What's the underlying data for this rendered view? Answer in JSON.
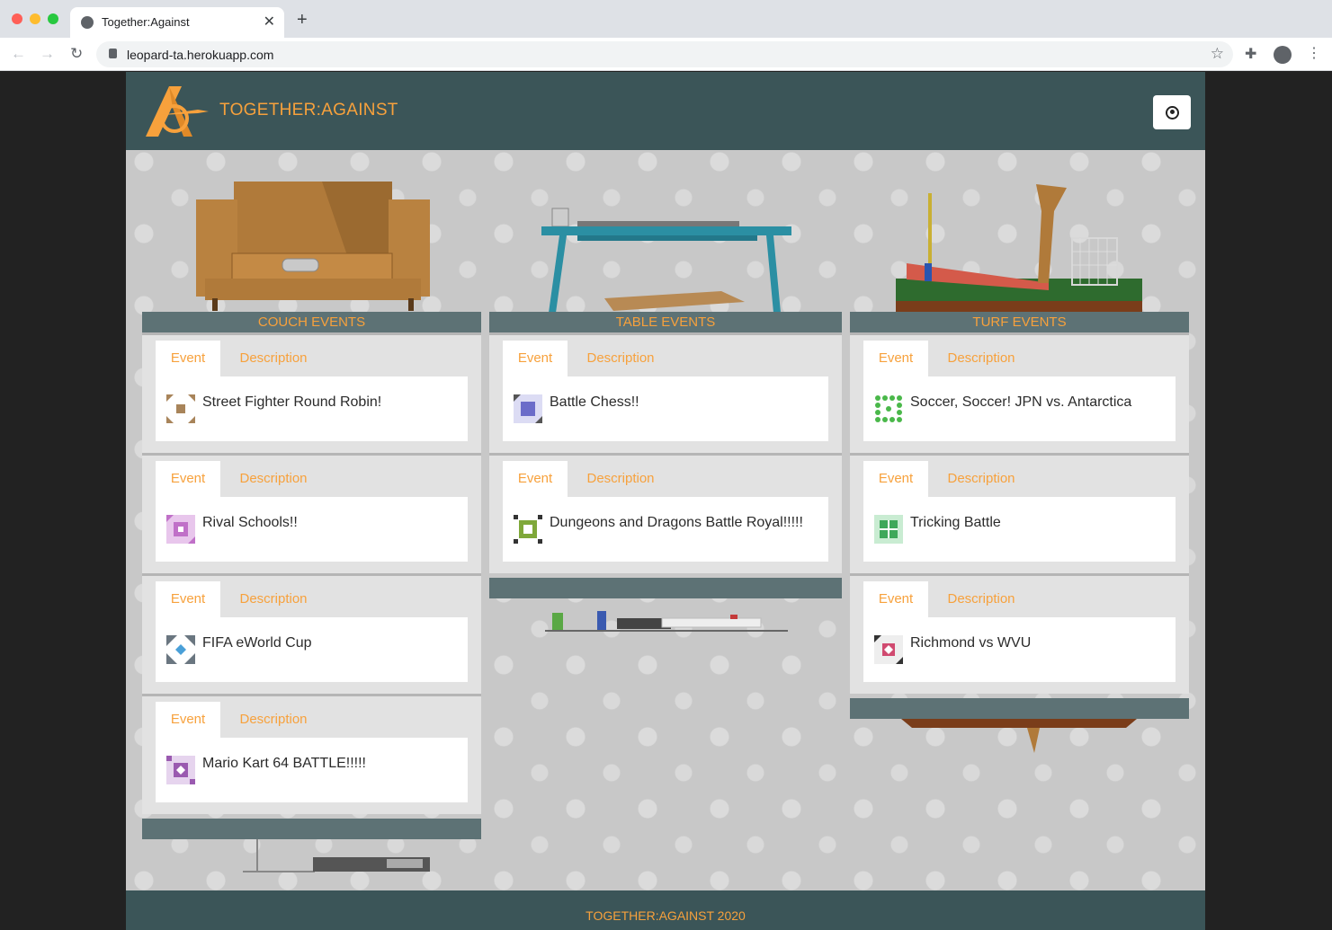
{
  "browser": {
    "tab_title": "Together:Against",
    "url": "leopard-ta.herokuapp.com"
  },
  "header": {
    "brand": "TOGETHER:AGAINST",
    "account_icon": "account-circle-icon"
  },
  "columns": [
    {
      "title": "COUCH EVENTS",
      "events": [
        {
          "tab_event": "Event",
          "tab_description": "Description",
          "name": "Street Fighter Round Robin!",
          "avatar_color": "#a8845a"
        },
        {
          "tab_event": "Event",
          "tab_description": "Description",
          "name": "Rival Schools!!",
          "avatar_color": "#c070c8"
        },
        {
          "tab_event": "Event",
          "tab_description": "Description",
          "name": "FIFA eWorld Cup",
          "avatar_color": "#6a7680"
        },
        {
          "tab_event": "Event",
          "tab_description": "Description",
          "name": "Mario Kart 64 BATTLE!!!!!",
          "avatar_color": "#9a5ab0"
        }
      ]
    },
    {
      "title": "TABLE EVENTS",
      "events": [
        {
          "tab_event": "Event",
          "tab_description": "Description",
          "name": "Battle Chess!!",
          "avatar_color": "#6b6cc9"
        },
        {
          "tab_event": "Event",
          "tab_description": "Description",
          "name": "Dungeons and Dragons Battle Royal!!!!!",
          "avatar_color": "#7fa83a"
        }
      ]
    },
    {
      "title": "TURF EVENTS",
      "events": [
        {
          "tab_event": "Event",
          "tab_description": "Description",
          "name": "Soccer, Soccer! JPN vs. Antarctica",
          "avatar_color": "#4ab84a"
        },
        {
          "tab_event": "Event",
          "tab_description": "Description",
          "name": "Tricking Battle",
          "avatar_color": "#3fa85a"
        },
        {
          "tab_event": "Event",
          "tab_description": "Description",
          "name": "Richmond vs WVU",
          "avatar_color": "#d04a70"
        }
      ]
    }
  ],
  "footer": {
    "text": "TOGETHER:AGAINST 2020"
  },
  "colors": {
    "header_bg": "#3b5558",
    "accent": "#f7a13c",
    "column_header_bg": "#5d7275"
  }
}
